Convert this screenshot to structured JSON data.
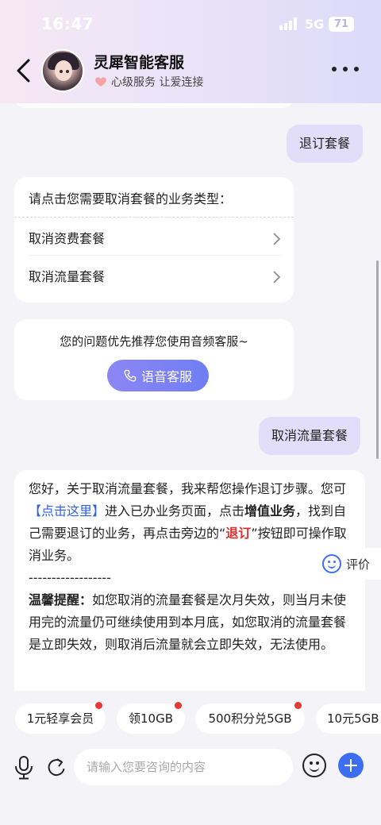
{
  "status_bar": {
    "time": "16:47",
    "network": "5G",
    "battery": "71"
  },
  "header": {
    "title": "灵犀智能客服",
    "subtitle": "心级服务 让爱连接"
  },
  "messages": {
    "user_1": "退订套餐",
    "menu_card": {
      "title": "请点击您需要取消套餐的业务类型：",
      "items": [
        {
          "label": "取消资费套餐"
        },
        {
          "label": "取消流量套餐"
        }
      ]
    },
    "voice_card": {
      "text": "您的问题优先推荐您使用音频客服~",
      "button": "语音客服"
    },
    "user_2": "取消流量套餐",
    "answer": {
      "p1_a": "您好，关于取消流量套餐，我来帮您操作退订步骤。您可",
      "p1_link": "【点击这里】",
      "p1_b": "进入已办业务页面，点击",
      "p1_bold": "增值业务",
      "p1_c": "，找到自己需要退订的业务，再点击旁边的“",
      "p1_red": "退订",
      "p1_d": "”按钮即可操作取消业务。",
      "separator": "------------------",
      "tip_label": "温馨提醒：",
      "tip_text": "如您取消的流量套餐是次月失效，则当月未使用完的流量仍可继续使用到本月底，如您取消的流量套餐是立即失效，则取消后流量就会立即失效，无法使用。"
    },
    "rate_label": "评价"
  },
  "chips": [
    {
      "label": "1元轻享会员"
    },
    {
      "label": "领10GB"
    },
    {
      "label": "500积分兑5GB"
    },
    {
      "label": "10元5GB"
    }
  ],
  "input": {
    "placeholder": "请输入您要咨询的内容"
  },
  "colors": {
    "accent": "#3d6ef2",
    "user_bubble": "#e2ddf8",
    "red": "#e03030"
  }
}
